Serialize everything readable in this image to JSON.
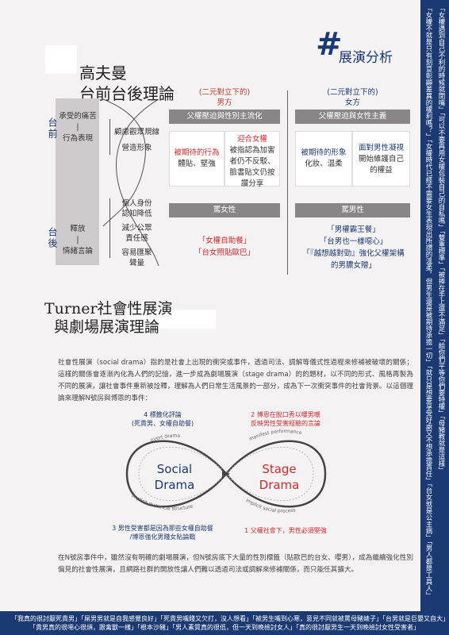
{
  "right_strip": {
    "col1": "「女權不就是只有刻意彰顯差異的權利嗎？」「女權時代已經不需要女生表現出所謂的溫柔，但男生還是被期待承擔一切」「就只是想要享受好處又不想承擔責任」「台女就是公主病」「男人都是工具人」",
    "col2": "「女權遇到自己不利的時候就閉嘴」「可以不要再用女權包裝自己的自私嗎」「雙重標準」「被捧在手上還不滿足」「給你們平等你們要特權」「母豬教就是這樣」"
  },
  "bottom_strip": {
    "line1": "「我真的很討厭死貴男」「屌男男就是自我感覺良好」「死貴男嘴賤又欠打，沒人想看」「被男生嘴到心寒，意見不同就被罵母豬婊子」「台男就是巨嬰又自大」",
    "line2": "「貴男真的很噁心很煩，跟禽獸一樣」「根本沙豬」「男人素質真的很低，但一天到晚檢討女人」「真的很討厭男生一天到晚檢討女性受害者」"
  },
  "header": {
    "title_line1": "高夫曼",
    "title_line2": "台前台後理論",
    "section_title": "展演分析"
  },
  "left": {
    "front_label": "台前",
    "back_label": "台後",
    "front_cell": [
      "承受的痛苦",
      "|",
      "行為表現"
    ],
    "back_cell": [
      "釋放",
      "|",
      "情緒言論"
    ],
    "front_items": [
      "顧慮觀眾規線",
      "營造形象"
    ],
    "back_items": [
      "個人身份",
      "認知降低",
      "減少公眾",
      "責任感",
      "容易匯聚",
      "聲量"
    ]
  },
  "male": {
    "head": [
      "(二元對立下的)",
      "男方"
    ],
    "bar": "父權壓迫與性別主流化",
    "box1": [
      "被期待的行為",
      "體貼、堅強"
    ],
    "box2_title": "迎合女權",
    "box2_lines": [
      "被指認為加害",
      "者仍不反駁、",
      "臉書貼文仍按",
      "讚分享"
    ],
    "lower_bar": "罵女性",
    "quotes": [
      "「女權自助餐」",
      "「台女照貼歐巴」"
    ]
  },
  "female": {
    "head": [
      "(二元對立下的)",
      "女方"
    ],
    "bar": "父權壓迫與女性主義",
    "box1": [
      "被期待的形象",
      "化妝、温柔"
    ],
    "box2": [
      "面對男性凝視",
      "開始維護自己",
      "的權益"
    ],
    "lower_bar": "罵男性",
    "quotes": [
      "「男權霸王餐」",
      "「台男也一樣噁心」",
      "「『越想越對勁』強化父權架構",
      "的男膿女贈」"
    ]
  },
  "turner": {
    "title_line1": "Turner社會性展演",
    "title_line2": "與劇場展演理論",
    "para1": "社會性展演（social drama）指的是社會上出現的衝突或事件，透過司法、調解等儀式性過程來修補被破壞的關係；這樣的關係會逐漸內化為人們的記憶，進一步成為劇場展演（stage drama）的的題材，以不同的形式、風格再製為不同的展演，讓社會事件重新被詮釋，理解為人們日常生活風景的一部分，成為下一次衝突事件的社會背景。以這個理論來理解N號房與博恩的事件：",
    "para2": "在N號房事件中，雖然沒有明確的劇場展演，但N號房底下大量的性別標籤（貼歐巴的台女、嚶男），成為繼續強化性別偏見的社會性展演，且網路社群的開放性讓人們難以透過司法或調解來修補關係，而只能任其擴大。"
  },
  "diagram": {
    "left_word1": "Social",
    "left_word2": "Drama",
    "right_word1": "Stage",
    "right_word2": "Drama",
    "label4_line1": "4 標籤化評論",
    "label4_line2": "(死貴男、女權自助餐)",
    "label2_line1": "2 博恩在脫口秀以嚶男嘲",
    "label2_line2": "反映男性受害經驗的言論",
    "label3_line1": "3 男性受害都是因為那些女權自助餐",
    "label3_line2": "/博恩強化男賤女貼論戰",
    "label1": "1 父權社會下，男性必須堅強",
    "arc_overt": "overt drama",
    "arc_manifest": "manifest performance",
    "arc_implicit_rhet": "implicit rhetorical structure",
    "arc_implicit_social": "implicit social process"
  },
  "colors": {
    "navy": "#1b3a73",
    "red": "#d0282e",
    "grey": "#8a8688"
  }
}
